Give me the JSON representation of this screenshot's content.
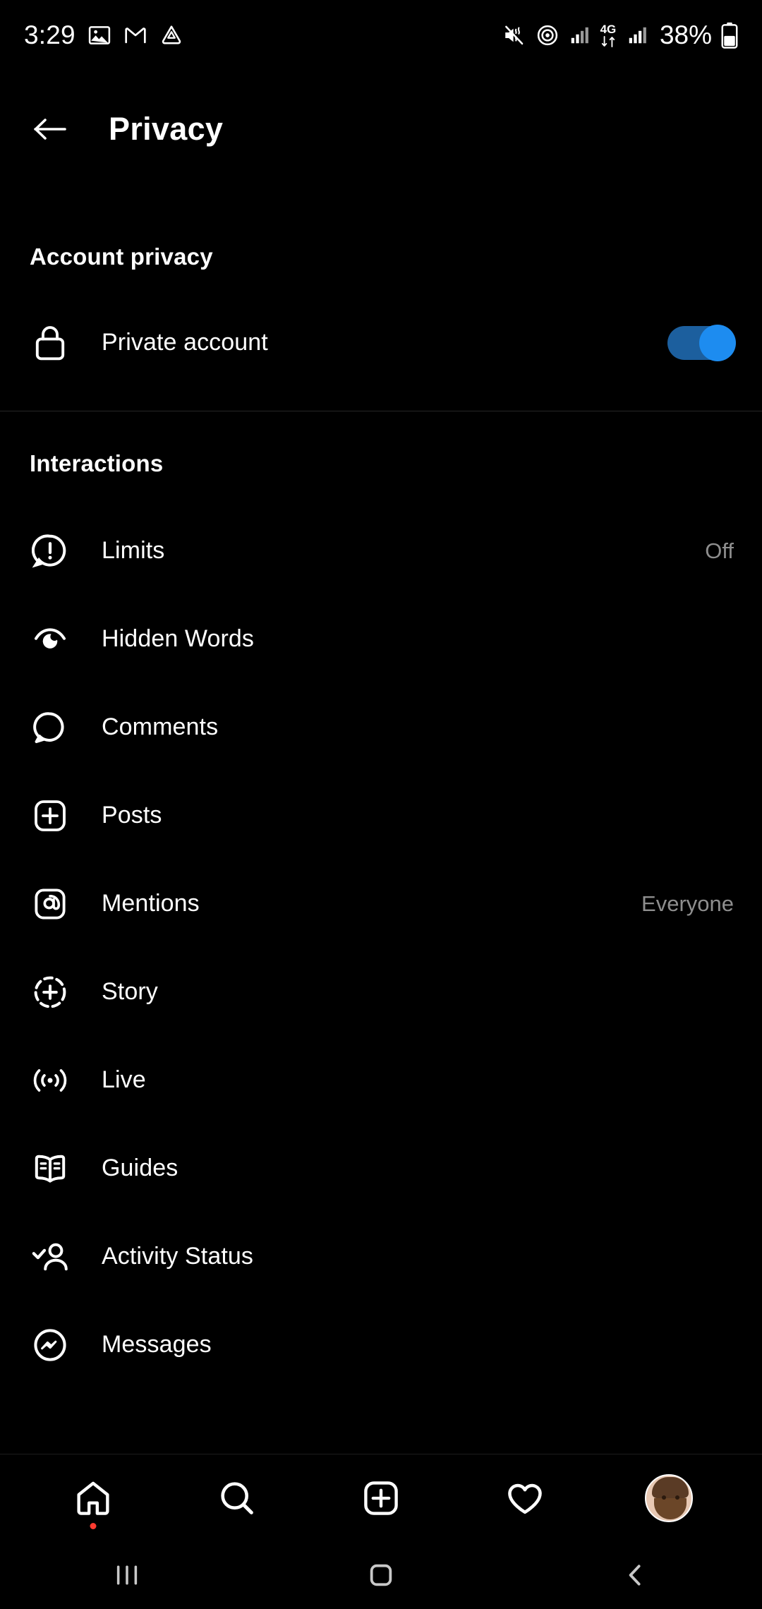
{
  "statusbar": {
    "time": "3:29",
    "battery_text": "38%",
    "network_label": "4G",
    "icons": [
      "photos-icon",
      "gmail-icon",
      "drive-icon",
      "mute-vibrate-icon",
      "hotspot-icon",
      "signal-bars-icon",
      "data-transfer-icon",
      "signal-bars-2-icon",
      "battery-icon"
    ]
  },
  "header": {
    "title": "Privacy",
    "back_label": "Back"
  },
  "sections": [
    {
      "title": "Account privacy",
      "rows": [
        {
          "icon": "lock-icon",
          "label": "Private account",
          "control": "toggle",
          "toggle_on": true
        }
      ]
    },
    {
      "title": "Interactions",
      "rows": [
        {
          "icon": "limits-icon",
          "label": "Limits",
          "value": "Off"
        },
        {
          "icon": "hidden-words-icon",
          "label": "Hidden Words",
          "value": ""
        },
        {
          "icon": "comment-icon",
          "label": "Comments",
          "value": ""
        },
        {
          "icon": "posts-icon",
          "label": "Posts",
          "value": ""
        },
        {
          "icon": "mentions-icon",
          "label": "Mentions",
          "value": "Everyone"
        },
        {
          "icon": "story-icon",
          "label": "Story",
          "value": ""
        },
        {
          "icon": "live-icon",
          "label": "Live",
          "value": ""
        },
        {
          "icon": "guides-icon",
          "label": "Guides",
          "value": ""
        },
        {
          "icon": "activity-status-icon",
          "label": "Activity Status",
          "value": ""
        },
        {
          "icon": "messages-icon",
          "label": "Messages",
          "value": ""
        }
      ]
    }
  ],
  "bottomnav": {
    "items": [
      {
        "icon": "home-icon",
        "label": "Home",
        "badge": true
      },
      {
        "icon": "search-icon",
        "label": "Search",
        "badge": false
      },
      {
        "icon": "add-post-icon",
        "label": "Create",
        "badge": false
      },
      {
        "icon": "heart-icon",
        "label": "Activity",
        "badge": false
      },
      {
        "icon": "avatar",
        "label": "Profile",
        "badge": false
      }
    ]
  },
  "androidnav": {
    "items": [
      {
        "icon": "recents-icon",
        "label": "Recents"
      },
      {
        "icon": "home-square-icon",
        "label": "Home"
      },
      {
        "icon": "back-chevron-icon",
        "label": "Back"
      }
    ]
  },
  "colors": {
    "background": "#000000",
    "text": "#ffffff",
    "muted_text": "#8e8e8e",
    "divider": "#262626",
    "toggle_on": "#1d8cf0",
    "badge": "#ff3b30"
  }
}
